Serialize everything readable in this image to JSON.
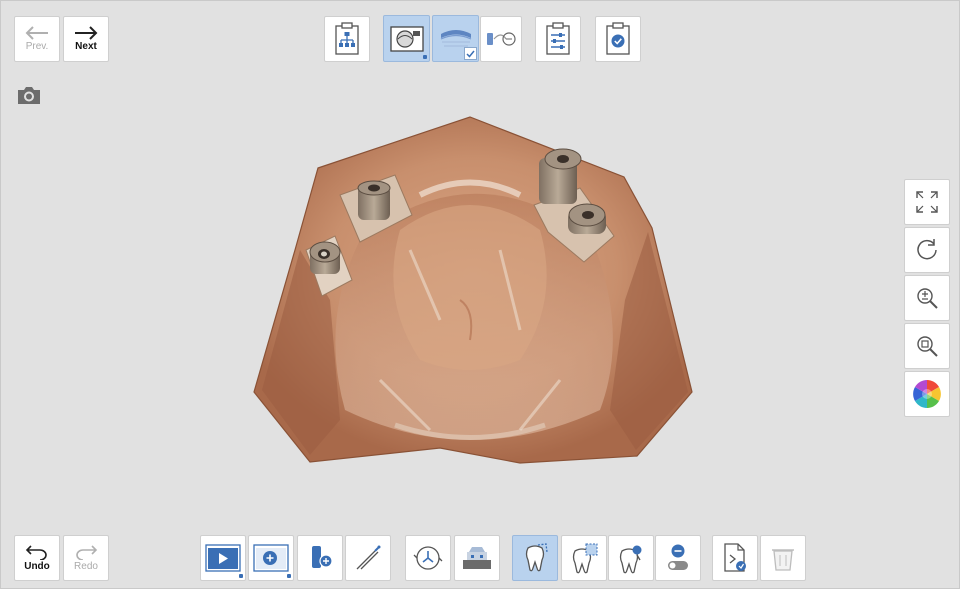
{
  "nav": {
    "prev_label": "Prev.",
    "next_label": "Next"
  },
  "edit": {
    "undo_label": "Undo",
    "redo_label": "Redo"
  },
  "top_toolbar": {
    "icons": [
      "workflow-tree-icon",
      "scan-data-icon",
      "arch-scan-icon",
      "scan-body-match-icon",
      "settings-sliders-icon",
      "checklist-complete-icon"
    ],
    "active": [
      "scan-data-icon",
      "arch-scan-icon"
    ]
  },
  "right_toolbar": {
    "icons": [
      "fit-to-screen-icon",
      "reset-rotation-icon",
      "zoom-icon",
      "zoom-area-icon",
      "color-map-icon"
    ]
  },
  "bottom_toolbar": {
    "icons": [
      "play-scan-icon",
      "add-scan-icon",
      "add-scanbody-icon",
      "trim-tool-icon",
      "rotate-view-icon",
      "scan-tray-icon",
      "tooth-region-icon",
      "tooth-select-icon",
      "tooth-target-icon",
      "toggle-off-icon",
      "export-file-icon",
      "trash-icon"
    ],
    "active": [
      "tooth-region-icon"
    ]
  },
  "colors": {
    "active_bg": "#b9d2ee",
    "accent": "#3a6fb5",
    "model_tone": "#c99270"
  }
}
